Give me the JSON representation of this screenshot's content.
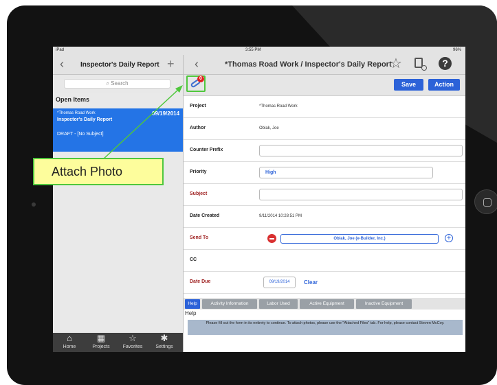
{
  "status_bar": {
    "left": "iPad",
    "time": "3:55 PM",
    "right": "96%"
  },
  "left_pane": {
    "title": "Inspector's Daily Report",
    "search_placeholder": "Search",
    "section_title": "Open Items",
    "item": {
      "project": "*Thomas Road Work",
      "date": "09/19/2014",
      "title": "Inspector's Daily Report",
      "status": "DRAFT - [No Subject]"
    },
    "tabs": [
      {
        "label": "Home",
        "icon": "home-icon"
      },
      {
        "label": "Projects",
        "icon": "building-icon"
      },
      {
        "label": "Favorites",
        "icon": "star-icon"
      },
      {
        "label": "Settings",
        "icon": "gear-icon"
      }
    ]
  },
  "right_pane": {
    "title": "*Thomas Road Work / Inspector's Daily Report",
    "attachment_count": "0",
    "save_label": "Save",
    "action_label": "Action",
    "form": {
      "project_label": "Project",
      "project_value": "*Thomas Road Work",
      "author_label": "Author",
      "author_value": "Oblak, Joe",
      "counter_prefix_label": "Counter Prefix",
      "counter_prefix_value": "",
      "priority_label": "Priority",
      "priority_value": "High",
      "subject_label": "Subject",
      "subject_value": "",
      "date_created_label": "Date Created",
      "date_created_value": "9/11/2014 10:28:51 PM",
      "send_to_label": "Send To",
      "send_to_value": "Oblak, Joe (e-Builder, Inc.)",
      "cc_label": "CC",
      "date_due_label": "Date Due",
      "date_due_value": "09/19/2014",
      "clear_label": "Clear"
    },
    "tabs": [
      "Help",
      "Activity Information",
      "Labor Used",
      "Active Equipment",
      "Inactive Equipment"
    ],
    "help_label": "Help",
    "help_text": "Please fill out the form in its entirety to continue. To attach photos, please use the \"Attached Files\" tab. For help, please contact Steven McCoy."
  },
  "annotation": {
    "text": "Attach Photo",
    "border_color": "#4fc73c",
    "fill_color": "#fdfd9c"
  },
  "colors": {
    "accent": "#2c62d8",
    "selected_item": "#2474e6",
    "required_label": "#9e1f1f"
  }
}
